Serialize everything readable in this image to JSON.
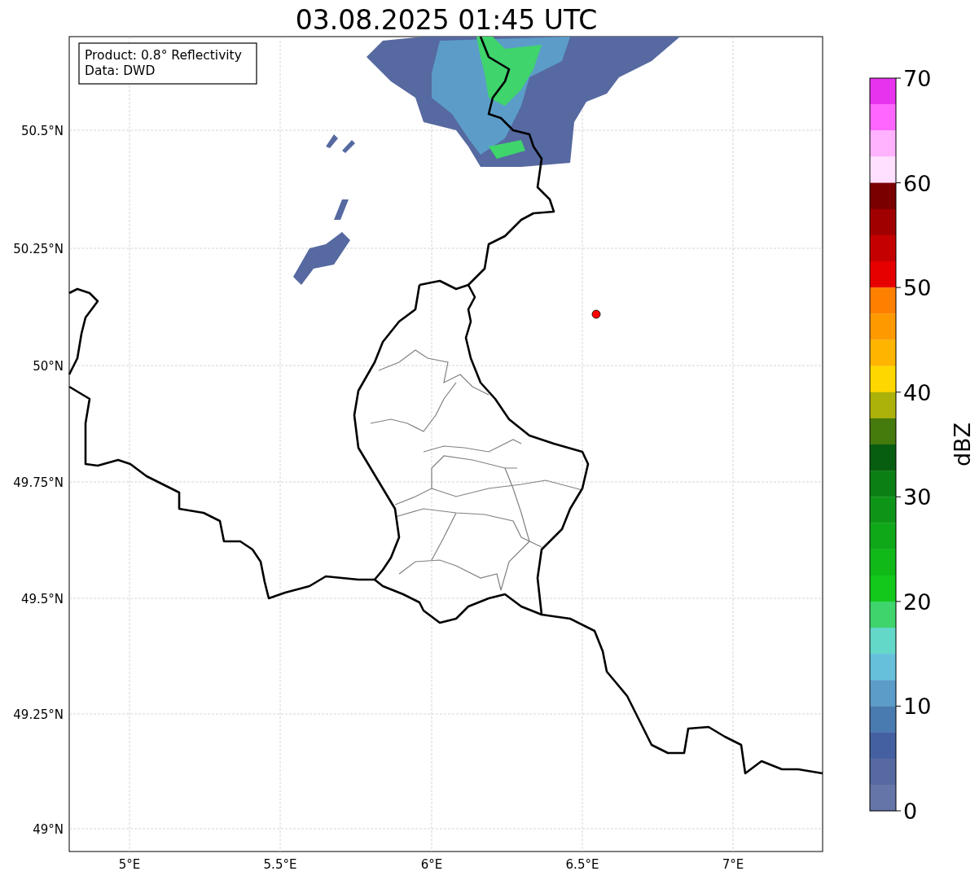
{
  "title": "03.08.2025 01:45 UTC",
  "info_box": [
    "Product: 0.8° Reflectivity",
    "Data: DWD"
  ],
  "map": {
    "lat_ticks": [
      "50.5°N",
      "50.25°N",
      "50°N",
      "49.75°N",
      "49.5°N",
      "49.25°N",
      "49°N"
    ],
    "lon_ticks": [
      "5°E",
      "5.5°E",
      "6°E",
      "6.5°E",
      "7°E"
    ]
  },
  "colorbar": {
    "label": "dBZ",
    "ticks": [
      "70",
      "60",
      "50",
      "40",
      "30",
      "20",
      "10",
      "0"
    ],
    "bands": [
      {
        "color": "#e833ee"
      },
      {
        "color": "#ff66ff"
      },
      {
        "color": "#ffb3ff"
      },
      {
        "color": "#ffe0ff"
      },
      {
        "color": "#7a0000"
      },
      {
        "color": "#a00000"
      },
      {
        "color": "#c40000"
      },
      {
        "color": "#e60000"
      },
      {
        "color": "#ff7f00"
      },
      {
        "color": "#ff9900"
      },
      {
        "color": "#ffb400"
      },
      {
        "color": "#ffd700"
      },
      {
        "color": "#adb20a"
      },
      {
        "color": "#457a0c"
      },
      {
        "color": "#085e10"
      },
      {
        "color": "#0b7f14"
      },
      {
        "color": "#0e9518"
      },
      {
        "color": "#0fa818"
      },
      {
        "color": "#10b818"
      },
      {
        "color": "#12c81a"
      },
      {
        "color": "#3fd46c"
      },
      {
        "color": "#63d8c8"
      },
      {
        "color": "#66c0dc"
      },
      {
        "color": "#5b9dc8"
      },
      {
        "color": "#4a7bb0"
      },
      {
        "color": "#4460a0"
      },
      {
        "color": "#5669a0"
      },
      {
        "color": "#6675a8"
      }
    ]
  }
}
